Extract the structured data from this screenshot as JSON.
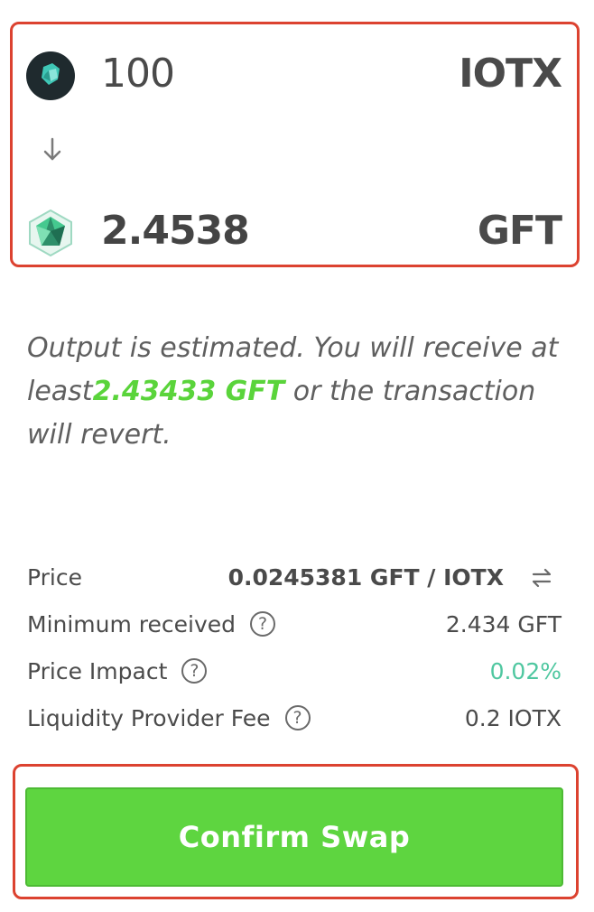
{
  "swap": {
    "from": {
      "amount": "100",
      "symbol": "IOTX",
      "icon": "iotx-token-icon"
    },
    "to": {
      "amount": "2.4538",
      "symbol": "GFT",
      "icon": "gft-token-icon"
    },
    "direction_icon": "arrow-down-icon"
  },
  "estimate": {
    "prefix": "Output is estimated. You will receive at least",
    "amount": "2.43433 GFT",
    "suffix": " or the transaction will revert."
  },
  "details": {
    "price": {
      "label": "Price",
      "value": "0.0245381 GFT / IOTX",
      "icon": "swap-rate-icon"
    },
    "minimum_received": {
      "label": "Minimum received",
      "value": "2.434 GFT"
    },
    "price_impact": {
      "label": "Price Impact",
      "value": "0.02%"
    },
    "liquidity_fee": {
      "label": "Liquidity Provider Fee",
      "value": "0.2 IOTX"
    },
    "help_glyph": "?"
  },
  "confirm_button": {
    "label": "Confirm Swap"
  },
  "colors": {
    "highlight_box": "#dc4230",
    "button_green": "#5ed540",
    "impact_teal": "#4fc7a0",
    "estimate_green": "#5ad43b"
  }
}
